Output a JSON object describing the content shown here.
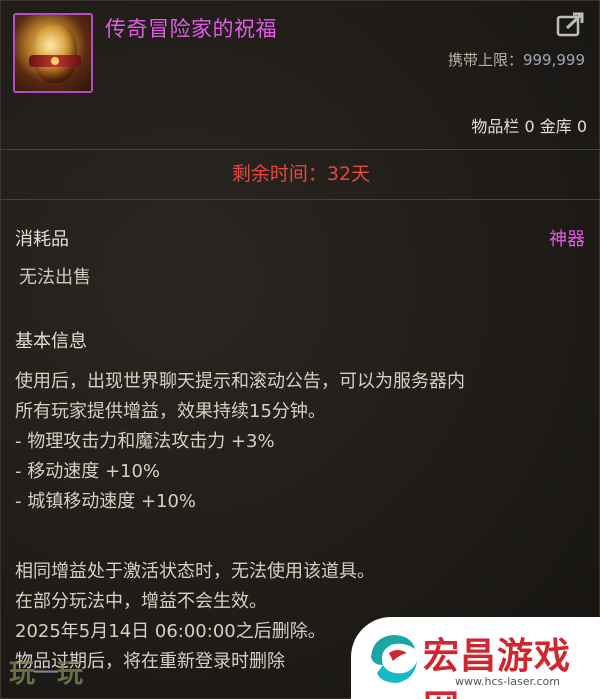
{
  "item": {
    "name": "传奇冒险家的祝福",
    "carry_limit_label": "携带上限：",
    "carry_limit_value": "999,999",
    "storage": "物品栏 0 金库 0",
    "icon": "golden-urn-icon"
  },
  "timer": {
    "text": "剩余时间：32天"
  },
  "type": {
    "category": "消耗品",
    "rarity": "神器",
    "sell": "无法出售"
  },
  "info": {
    "title": "基本信息",
    "lines": [
      "使用后，出现世界聊天提示和滚动公告，可以为服务器内",
      "所有玩家提供增益，效果持续15分钟。",
      "- 物理攻击力和魔法攻击力 +3%",
      "- 移动速度 +10%",
      "- 城镇移动速度 +10%"
    ]
  },
  "notes": [
    "相同增益处于激活状态时，无法使用该道具。",
    "在部分玩法中，增益不会生效。",
    "2025年5月14日 06:00:00之后删除。",
    "物品过期后，将在重新登录时删除"
  ],
  "watermark": {
    "left_text_a": "玩",
    "left_sep": "一",
    "left_text_b": "玩",
    "title": "宏昌游戏网",
    "url": "www.hcs-laser.com"
  },
  "colors": {
    "name": "#e45be8",
    "timer": "#e8473c",
    "rarity": "#e45be8"
  }
}
